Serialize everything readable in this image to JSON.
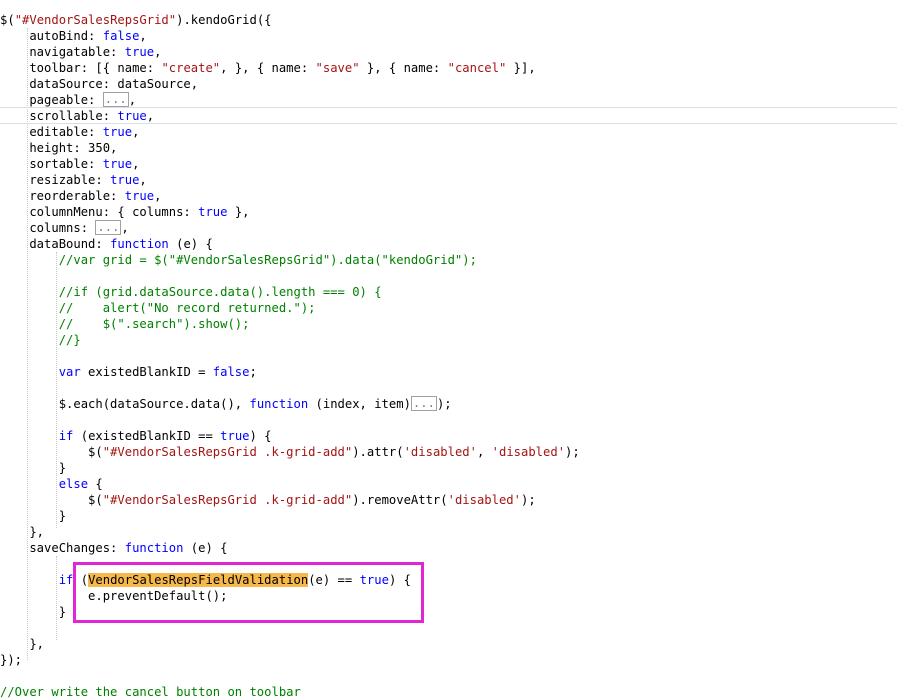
{
  "code": {
    "l1": {
      "a": "$(",
      "b": "\"#VendorSalesRepsGrid\"",
      "c": ").kendoGrid({"
    },
    "l2": {
      "a": "    autoBind: ",
      "b": "false",
      "c": ","
    },
    "l3": {
      "a": "    navigatable: ",
      "b": "true",
      "c": ","
    },
    "l4": {
      "a": "    toolbar: [{ name: ",
      "b": "\"create\"",
      "c": ", }, { name: ",
      "d": "\"save\"",
      "e": " }, { name: ",
      "f": "\"cancel\"",
      "g": " }],"
    },
    "l5": {
      "a": "    dataSource: dataSource,"
    },
    "l6": {
      "a": "    pageable: ",
      "fold": "...",
      "c": ","
    },
    "l7": {
      "a": "    scrollable: ",
      "b": "true",
      "c": ","
    },
    "l8": {
      "a": "    editable: ",
      "b": "true",
      "c": ","
    },
    "l9": {
      "a": "    height: 350,"
    },
    "l10": {
      "a": "    sortable: ",
      "b": "true",
      "c": ","
    },
    "l11": {
      "a": "    resizable: ",
      "b": "true",
      "c": ","
    },
    "l12": {
      "a": "    reorderable: ",
      "b": "true",
      "c": ","
    },
    "l13": {
      "a": "    columnMenu: { columns: ",
      "b": "true",
      "c": " },"
    },
    "l14": {
      "a": "    columns: ",
      "fold": "...",
      "c": ","
    },
    "l15": {
      "a": "    dataBound: ",
      "b": "function",
      "c": " (e) {"
    },
    "l16": {
      "cm": "        //var grid = $(\"#VendorSalesRepsGrid\").data(\"kendoGrid\");"
    },
    "l18": {
      "cm": "        //if (grid.dataSource.data().length === 0) {"
    },
    "l19": {
      "cm": "        //    alert(\"No record returned.\");"
    },
    "l20": {
      "cm": "        //    $(\".search\").show();"
    },
    "l21": {
      "cm": "        //}"
    },
    "l23": {
      "a": "        ",
      "b": "var",
      "c": " existedBlankID = ",
      "d": "false",
      "e": ";"
    },
    "l25": {
      "a": "        $.each(dataSource.data(), ",
      "b": "function",
      "c": " (index, item)",
      "fold": "...",
      "e": ");"
    },
    "l27": {
      "a": "        ",
      "b": "if",
      "c": " (existedBlankID == ",
      "d": "true",
      "e": ") {"
    },
    "l28": {
      "a": "            $(",
      "b": "\"#VendorSalesRepsGrid .k-grid-add\"",
      "c": ").attr(",
      "d": "'disabled'",
      "e": ", ",
      "f": "'disabled'",
      "g": ");"
    },
    "l29": {
      "a": "        }"
    },
    "l30": {
      "b": "        else",
      "c": " {"
    },
    "l31": {
      "a": "            $(",
      "b": "\"#VendorSalesRepsGrid .k-grid-add\"",
      "c": ").removeAttr(",
      "d": "'disabled'",
      "e": ");"
    },
    "l32": {
      "a": "        }"
    },
    "l33": {
      "a": "    },"
    },
    "l34": {
      "a": "    saveChanges: ",
      "b": "function",
      "c": " (e) {"
    },
    "l36": {
      "a": "        ",
      "b": "if",
      "c": " (",
      "hl": "VendorSalesRepsFieldValidation",
      "d": "(e) == ",
      "e": "true",
      "f": ") {"
    },
    "l37": {
      "a": "            e.preventDefault();"
    },
    "l38": {
      "a": "        }"
    },
    "l40": {
      "a": "    },"
    },
    "l41": {
      "a": "});"
    },
    "l43": {
      "cm": "//Over write the cancel button on toolbar"
    }
  },
  "colors": {
    "keyword": "#0000ff",
    "string": "#a31515",
    "comment": "#008000",
    "highlight": "#f7b84b",
    "annotation_box": "#e026d6"
  }
}
